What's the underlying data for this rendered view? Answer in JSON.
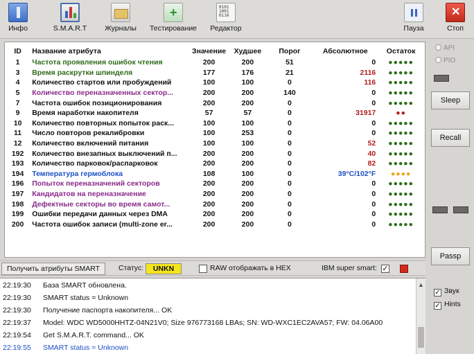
{
  "toolbar": {
    "items": [
      {
        "label": "Инфо",
        "icon": "info-icon"
      },
      {
        "label": "S.M.A.R.T",
        "icon": "smart-chart-icon"
      },
      {
        "label": "Журналы",
        "icon": "logs-folder-icon"
      },
      {
        "label": "Тестирование",
        "icon": "test-plus-icon"
      },
      {
        "label": "Редактор",
        "icon": "binary-editor-icon"
      }
    ],
    "pause_label": "Пауза",
    "stop_label": "Стоп"
  },
  "table": {
    "headers": {
      "id": "ID",
      "name": "Название атрибута",
      "value": "Значение",
      "worst": "Худшее",
      "threshold": "Порог",
      "absolute": "Абсолютное",
      "remaining": "Остаток"
    },
    "rows": [
      {
        "id": "1",
        "name": "Частота проявления ошибок чтения",
        "value": "200",
        "worst": "200",
        "threshold": "51",
        "absolute": "0",
        "remaining": "●●●●●",
        "name_color": "#2e6b1a",
        "rem_color": "#2e6b1a"
      },
      {
        "id": "3",
        "name": "Время раскрутки шпинделя",
        "value": "177",
        "worst": "176",
        "threshold": "21",
        "absolute": "2116",
        "remaining": "●●●●●",
        "name_color": "#2e6b1a",
        "rem_color": "#2e6b1a"
      },
      {
        "id": "4",
        "name": "Количество стартов или пробуждений",
        "value": "100",
        "worst": "100",
        "threshold": "0",
        "absolute": "116",
        "remaining": "●●●●●",
        "name_color": "#111111",
        "rem_color": "#2e6b1a"
      },
      {
        "id": "5",
        "name": "Количество переназначенных сектор...",
        "value": "200",
        "worst": "200",
        "threshold": "140",
        "absolute": "0",
        "remaining": "●●●●●",
        "name_color": "#8a2b8a",
        "rem_color": "#2e6b1a"
      },
      {
        "id": "7",
        "name": "Частота ошибок позиционирования",
        "value": "200",
        "worst": "200",
        "threshold": "0",
        "absolute": "0",
        "remaining": "●●●●●",
        "name_color": "#111111",
        "rem_color": "#2e6b1a"
      },
      {
        "id": "9",
        "name": "Время наработки накопителя",
        "value": "57",
        "worst": "57",
        "threshold": "0",
        "absolute": "31917",
        "remaining": "●●",
        "name_color": "#111111",
        "rem_color": "#b01c1c"
      },
      {
        "id": "10",
        "name": "Количество повторных попыток раск...",
        "value": "100",
        "worst": "100",
        "threshold": "0",
        "absolute": "0",
        "remaining": "●●●●●",
        "name_color": "#111111",
        "rem_color": "#2e6b1a"
      },
      {
        "id": "11",
        "name": "Число повторов рекалибровки",
        "value": "100",
        "worst": "253",
        "threshold": "0",
        "absolute": "0",
        "remaining": "●●●●●",
        "name_color": "#111111",
        "rem_color": "#2e6b1a"
      },
      {
        "id": "12",
        "name": "Количество включений питания",
        "value": "100",
        "worst": "100",
        "threshold": "0",
        "absolute": "52",
        "remaining": "●●●●●",
        "name_color": "#111111",
        "rem_color": "#2e6b1a"
      },
      {
        "id": "192",
        "name": "Количество внезапных выключений п...",
        "value": "200",
        "worst": "200",
        "threshold": "0",
        "absolute": "40",
        "remaining": "●●●●●",
        "name_color": "#111111",
        "rem_color": "#2e6b1a"
      },
      {
        "id": "193",
        "name": "Количество парковок/распарковок",
        "value": "200",
        "worst": "200",
        "threshold": "0",
        "absolute": "82",
        "remaining": "●●●●●",
        "name_color": "#111111",
        "rem_color": "#2e6b1a"
      },
      {
        "id": "194",
        "name": "Температура гермоблока",
        "value": "108",
        "worst": "100",
        "threshold": "0",
        "absolute": "39°C/102°F",
        "remaining": "●●●●",
        "name_color": "#1c4fc4",
        "rem_color": "#e6a51c"
      },
      {
        "id": "196",
        "name": "Попыток переназначений секторов",
        "value": "200",
        "worst": "200",
        "threshold": "0",
        "absolute": "0",
        "remaining": "●●●●●",
        "name_color": "#8a2b8a",
        "rem_color": "#2e6b1a"
      },
      {
        "id": "197",
        "name": "Кандидатов на переназначение",
        "value": "200",
        "worst": "200",
        "threshold": "0",
        "absolute": "0",
        "remaining": "●●●●●",
        "name_color": "#8a2b8a",
        "rem_color": "#2e6b1a"
      },
      {
        "id": "198",
        "name": "Дефектные секторы во время самот...",
        "value": "200",
        "worst": "200",
        "threshold": "0",
        "absolute": "0",
        "remaining": "●●●●●",
        "name_color": "#8a2b8a",
        "rem_color": "#2e6b1a"
      },
      {
        "id": "199",
        "name": "Ошибки передачи данных через DMA",
        "value": "200",
        "worst": "200",
        "threshold": "0",
        "absolute": "0",
        "remaining": "●●●●●",
        "name_color": "#111111",
        "rem_color": "#2e6b1a"
      },
      {
        "id": "200",
        "name": "Частота ошибок записи (multi-zone er...",
        "value": "200",
        "worst": "200",
        "threshold": "0",
        "absolute": "0",
        "remaining": "●●●●●",
        "name_color": "#111111",
        "rem_color": "#2e6b1a"
      }
    ]
  },
  "status_strip": {
    "get_button": "Получить атрибуты SMART",
    "status_label": "Статус:",
    "status_value": "UNKN",
    "raw_hex_label": "RAW отображать в HEX",
    "ibm_label": "IBM super smart:",
    "ibm_checked": "✓"
  },
  "log": [
    {
      "time": "22:19:30",
      "text": "База SMART обновлена.",
      "color": "#111111"
    },
    {
      "time": "22:19:30",
      "text": "SMART status = Unknown",
      "color": "#111111"
    },
    {
      "time": "22:19:30",
      "text": "Получение паспорта накопителя... OK",
      "color": "#111111"
    },
    {
      "time": "22:19:37",
      "text": "Model: WDC WD5000HHTZ-04N21V0; Size 976773168 LBAs; SN: WD-WXC1EC2AVA57; FW: 04.06A00",
      "color": "#111111"
    },
    {
      "time": "22:19:54",
      "text": "Get S.M.A.R.T. command... OK",
      "color": "#111111"
    },
    {
      "time": "22:19:55",
      "text": "SMART status = Unknown",
      "color": "#1c4fc4"
    }
  ],
  "side": {
    "radio_api": "API",
    "radio_pio": "PIO",
    "sleep_label": "Sleep",
    "recall_label": "Recall",
    "passp_label": "Passp",
    "sound_label": "Звук",
    "hints_label": "Hints",
    "checked_mark": "✓"
  }
}
